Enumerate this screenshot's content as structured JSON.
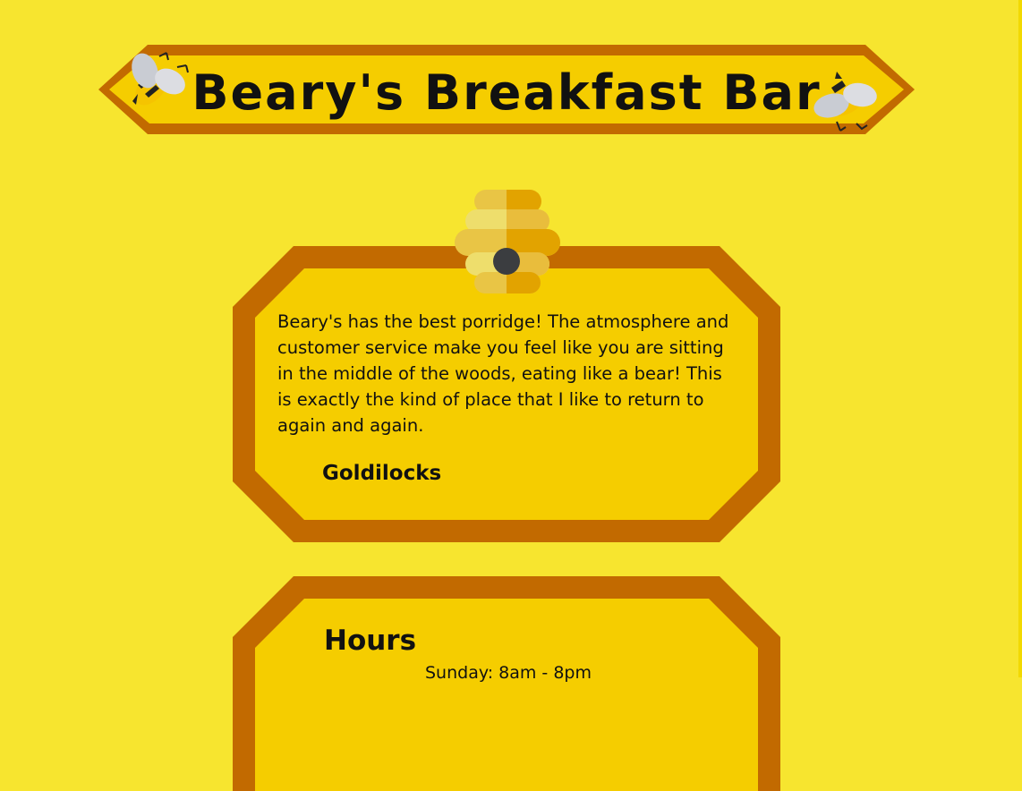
{
  "header": {
    "title": "Beary's Breakfast Bar",
    "left_icon": "bee-icon",
    "right_icon": "bee-icon"
  },
  "review": {
    "icon": "beehive-icon",
    "text": "Beary's has the best porridge! The atmosphere and customer service make you feel like you are sitting in the middle of the woods, eating like a bear! This is exactly the kind of place that I like to return to again and again.",
    "author": "Goldilocks"
  },
  "hours": {
    "title": "Hours",
    "lines": [
      "Sunday: 8am - 8pm"
    ]
  },
  "colors": {
    "background": "#f7e52f",
    "frame": "#c26a00",
    "panel": "#f5cd00",
    "text": "#111111"
  }
}
